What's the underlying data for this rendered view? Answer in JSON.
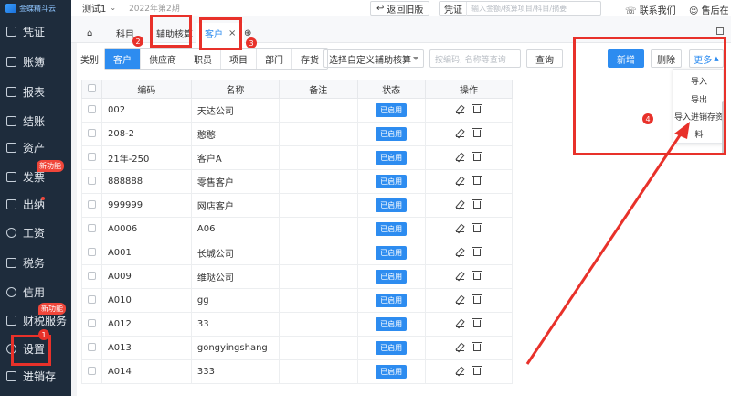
{
  "brand": "金蝶精斗云",
  "topbar": {
    "account": "测试1",
    "period": "2022年第2期",
    "old_version": "返回旧版",
    "search_type": "凭证",
    "search_placeholder": "输入金额/核算项目/科目/摘要",
    "contact": "联系我们",
    "service": "售后在线"
  },
  "sidebar": {
    "items": [
      {
        "label": "凭证"
      },
      {
        "label": "账簿"
      },
      {
        "label": "报表"
      },
      {
        "label": "结账"
      },
      {
        "label": "资产"
      },
      {
        "label": "发票"
      },
      {
        "label": "出纳"
      },
      {
        "label": "工资"
      },
      {
        "label": "税务"
      },
      {
        "label": "信用"
      },
      {
        "label": "财税服务"
      },
      {
        "label": "设置"
      },
      {
        "label": "进销存"
      }
    ],
    "new_badge": "新功能"
  },
  "tabs": [
    {
      "label": "科目"
    },
    {
      "label": "辅助核算"
    },
    {
      "label": "客户"
    }
  ],
  "filter": {
    "category_label": "类别",
    "categories": [
      "客户",
      "供应商",
      "职员",
      "项目",
      "部门",
      "存货"
    ],
    "custom_select": "选择自定义辅助核算",
    "code_placeholder": "按编码, 名称等查询",
    "query": "查询"
  },
  "actions": {
    "new": "新增",
    "delete": "删除",
    "more": "更多"
  },
  "dropdown": {
    "items": [
      "导入",
      "导出",
      "导入进销存资",
      "料"
    ]
  },
  "table": {
    "headers": [
      "编码",
      "名称",
      "备注",
      "状态",
      "操作"
    ],
    "rows": [
      {
        "code": "002",
        "name": "天达公司",
        "remark": "",
        "status": "已启用"
      },
      {
        "code": "208-2",
        "name": "憨憨",
        "remark": "",
        "status": "已启用"
      },
      {
        "code": "21年-250",
        "name": "客户A",
        "remark": "",
        "status": "已启用"
      },
      {
        "code": "888888",
        "name": "零售客户",
        "remark": "",
        "status": "已启用"
      },
      {
        "code": "999999",
        "name": "网店客户",
        "remark": "",
        "status": "已启用"
      },
      {
        "code": "A0006",
        "name": "A06",
        "remark": "",
        "status": "已启用"
      },
      {
        "code": "A001",
        "name": "长城公司",
        "remark": "",
        "status": "已启用"
      },
      {
        "code": "A009",
        "name": "维哒公司",
        "remark": "",
        "status": "已启用"
      },
      {
        "code": "A010",
        "name": "gg",
        "remark": "",
        "status": "已启用"
      },
      {
        "code": "A012",
        "name": "33",
        "remark": "",
        "status": "已启用"
      },
      {
        "code": "A013",
        "name": "gongyingshang",
        "remark": "",
        "status": "已启用"
      },
      {
        "code": "A014",
        "name": "333",
        "remark": "",
        "status": "已启用"
      }
    ]
  },
  "annotations": {
    "n1": "1",
    "n2": "2",
    "n3": "3",
    "n4": "4"
  },
  "colors": {
    "primary": "#2d8cf0",
    "annotation": "#e8312a",
    "sidebar_bg": "#1e2c3c"
  }
}
